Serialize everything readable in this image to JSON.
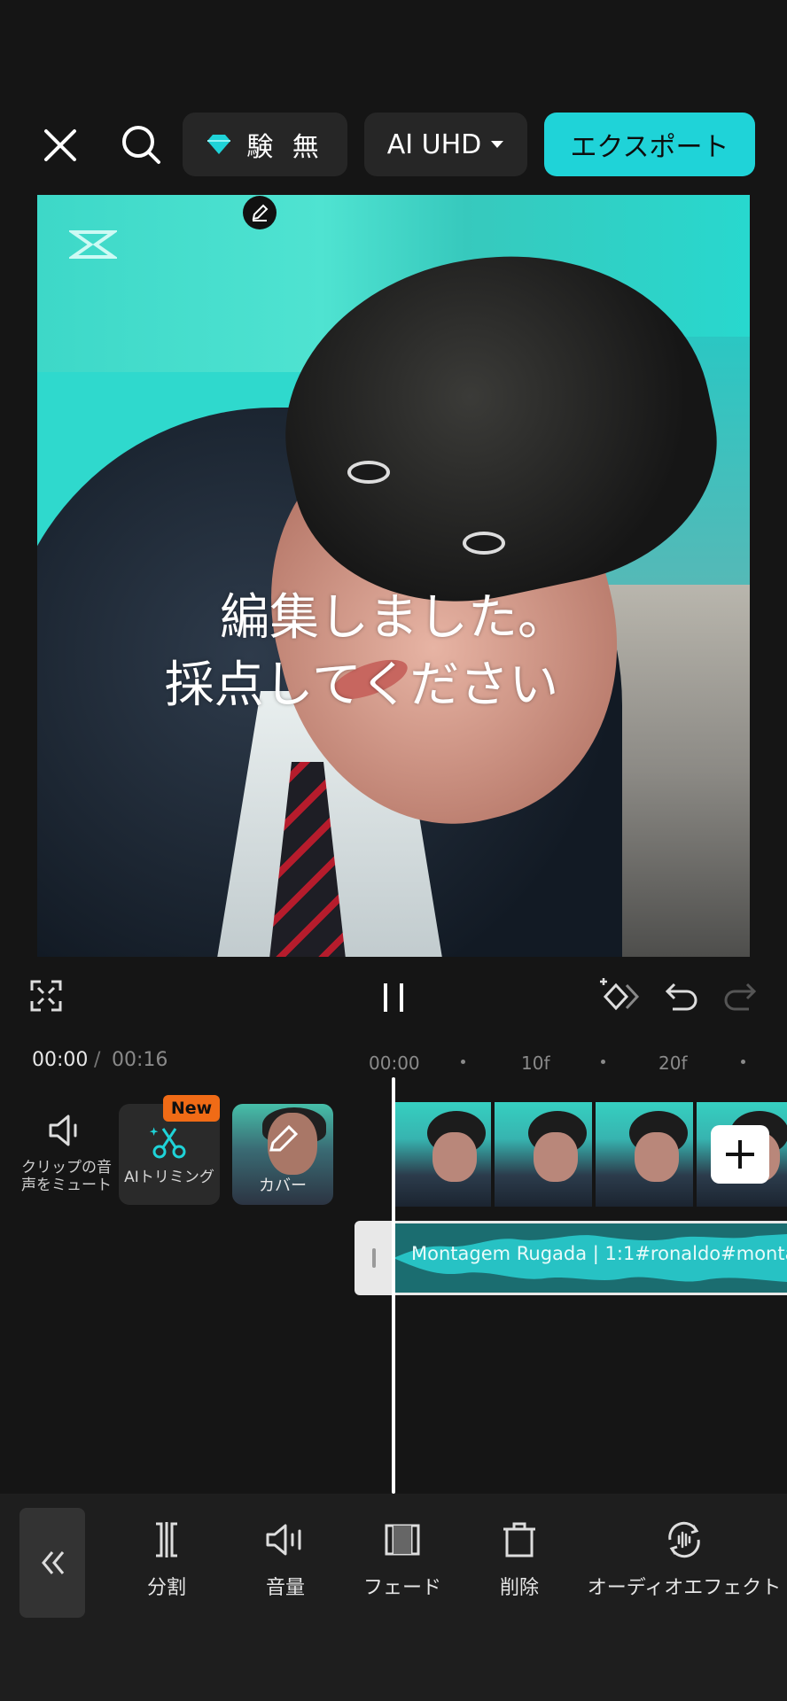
{
  "header": {
    "trial_text": "験 無",
    "quality_label": "AI UHD",
    "export_label": "エクスポート"
  },
  "preview": {
    "caption_line1": "編集しました。",
    "caption_line2": "採点してください"
  },
  "timeline": {
    "current_time": "00:00",
    "separator": "/",
    "total_time": "00:16",
    "ruler": [
      "00:00",
      "10f",
      "20f"
    ]
  },
  "tracks": {
    "mute_label": "クリップの音声をミュート",
    "ai_trim_label": "AIトリミング",
    "new_badge": "New",
    "cover_label": "カバー",
    "audio_title": "Montagem Rugada | 1:1#ronaldo#monta"
  },
  "toolbar": {
    "tools": [
      {
        "label": "分割",
        "icon": "split-icon"
      },
      {
        "label": "音量",
        "icon": "volume-icon"
      },
      {
        "label": "フェード",
        "icon": "fade-icon"
      },
      {
        "label": "削除",
        "icon": "delete-icon"
      },
      {
        "label": "オーディオエフェクト",
        "icon": "audio-effect-icon"
      }
    ]
  },
  "colors": {
    "accent": "#1fd3d8",
    "badge": "#f06b16",
    "background": "#151515"
  }
}
